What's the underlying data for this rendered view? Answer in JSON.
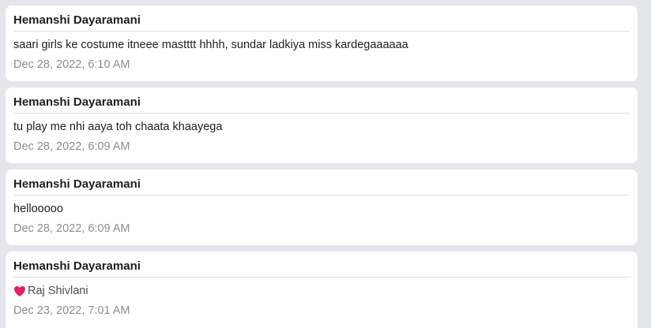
{
  "messages": [
    {
      "author": "Hemanshi Dayaramani",
      "text": "saari girls ke costume itneee mastttt hhhh, sundar ladkiya miss kardegaaaaaa",
      "timestamp": "Dec 28, 2022, 6:10 AM"
    },
    {
      "author": "Hemanshi Dayaramani",
      "text": "tu play me nhi aaya toh chaata khaayega",
      "timestamp": "Dec 28, 2022, 6:09 AM"
    },
    {
      "author": "Hemanshi Dayaramani",
      "text": "hellooooo",
      "timestamp": "Dec 28, 2022, 6:09 AM"
    },
    {
      "author": "Hemanshi Dayaramani",
      "reaction": {
        "icon": "heart-icon",
        "color": "#e0245e",
        "target_name": "Raj Shivlani"
      },
      "timestamp": "Dec 23, 2022, 7:01 AM"
    }
  ],
  "colors": {
    "background": "#e4e6eb",
    "card": "#ffffff",
    "author_text": "#1c1e21",
    "timestamp_text": "#8a8d91",
    "divider": "#dadde1"
  }
}
